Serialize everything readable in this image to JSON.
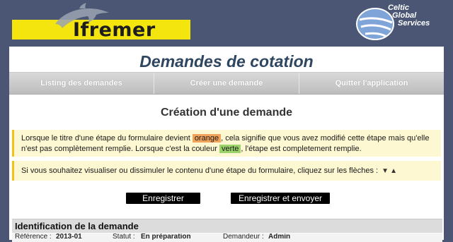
{
  "header": {
    "logo_text": "Ifremer",
    "partner_lines": [
      "Celtic",
      "Global",
      "Services"
    ]
  },
  "page": {
    "title": "Demandes de cotation"
  },
  "nav": {
    "items": [
      {
        "label": "Listing des demandes"
      },
      {
        "label": "Créer une demande"
      },
      {
        "label": "Quitter l'application"
      }
    ]
  },
  "form": {
    "heading": "Création d'une demande",
    "notice1": {
      "part1": "Lorsque le titre d'une étape du formulaire devient ",
      "highlight_orange": "orange",
      "part2": ", cela signifie que vous avez modifié cette étape mais qu'elle n'est pas complètement remplie. Lorsque c'est la couleur ",
      "highlight_green": "verte",
      "part3": ", l'étape est completement remplie."
    },
    "notice2": "Si vous souhaitez visualiser ou dissimuler le contenu d'une étape du formulaire, cliquez sur les flèches :",
    "buttons": {
      "save": "Enregistrer",
      "save_send": "Enregistrer et envoyer"
    },
    "section": {
      "title": "Identification de la demande",
      "reference_label": "Référence :",
      "reference_value": "2013-01",
      "status_label": "Statut :",
      "status_value": "En préparation",
      "requester_label": "Demandeur :",
      "requester_value": "Admin"
    }
  },
  "colors": {
    "background": "#4a5673",
    "logo_yellow": "#f5e50f",
    "title_blue": "#2e4660",
    "highlight_orange": "#f0a35a",
    "highlight_green": "#9bd36a"
  },
  "icons": [
    "dolphin-logo-icon",
    "celtic-globe-logo-icon",
    "arrow-down-icon",
    "arrow-up-icon"
  ]
}
